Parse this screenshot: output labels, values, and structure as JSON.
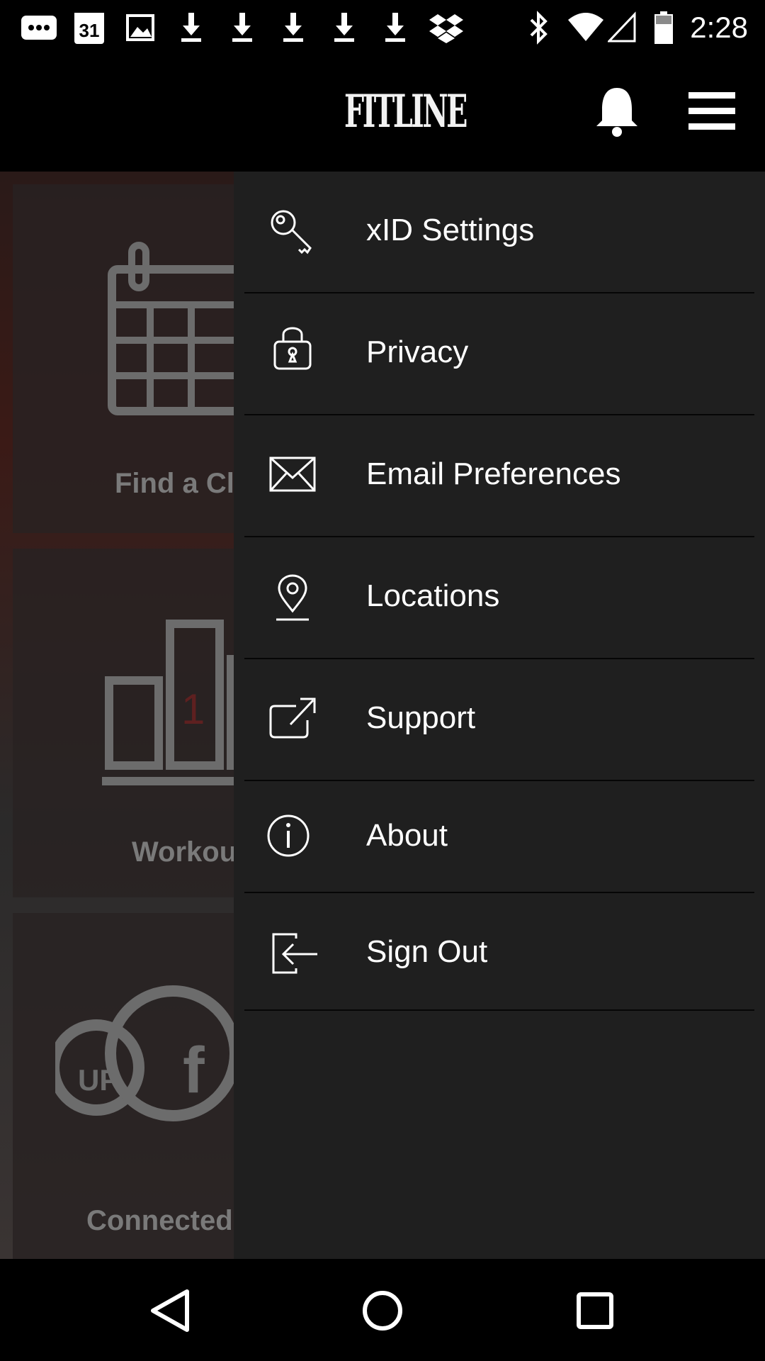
{
  "status_bar": {
    "time": "2:28",
    "calendar_day": "31",
    "icons": [
      "sms-icon",
      "calendar-icon",
      "image-icon",
      "download-icon",
      "download-icon",
      "download-icon",
      "download-icon",
      "download-icon",
      "dropbox-icon",
      "bluetooth-icon",
      "wifi-icon",
      "signal-icon",
      "battery-icon"
    ]
  },
  "header": {
    "logo": "FITLINE",
    "bell_icon": "bell-icon",
    "menu_icon": "hamburger-menu-icon"
  },
  "background": {
    "tiles": [
      {
        "label": "Find a Cla",
        "icon": "calendar-icon"
      },
      {
        "label": "Workou",
        "icon": "bar-chart-icon",
        "value": "1"
      },
      {
        "label": "Connected",
        "icon": "connected-apps-icon",
        "app_badge": "UP",
        "app_letter": "f"
      }
    ]
  },
  "drawer": {
    "items": [
      {
        "label": "xID Settings",
        "icon": "key-icon"
      },
      {
        "label": "Privacy",
        "icon": "lock-icon"
      },
      {
        "label": "Email Preferences",
        "icon": "envelope-icon"
      },
      {
        "label": "Locations",
        "icon": "location-pin-icon"
      },
      {
        "label": "Support",
        "icon": "external-link-icon"
      },
      {
        "label": "About",
        "icon": "info-icon"
      },
      {
        "label": "Sign Out",
        "icon": "sign-out-icon"
      }
    ]
  },
  "nav_bar": {
    "icons": [
      "back-icon",
      "home-icon",
      "recents-icon"
    ]
  }
}
